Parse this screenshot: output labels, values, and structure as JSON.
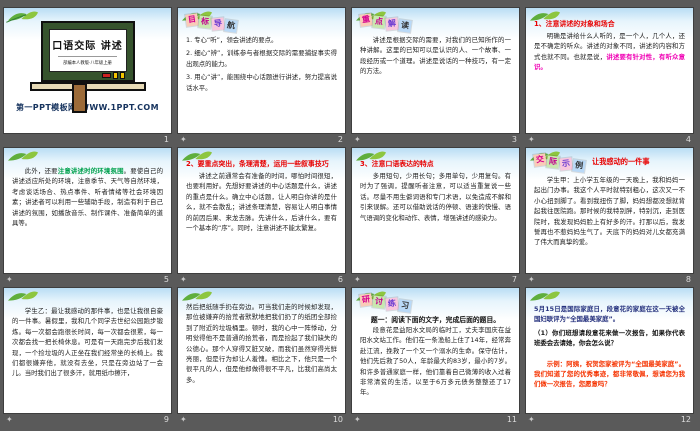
{
  "app": {
    "view_background": "#5a5a5a"
  },
  "colors": {
    "heading_red": "#e80000",
    "highlight_magenta": "#f000b4",
    "highlight_green": "#00a14e",
    "sample_red": "#f53300",
    "navy": "#26327e",
    "sky": "#b9ddf4"
  },
  "icons": {
    "animation_star": "✦"
  },
  "slides": [
    {
      "number": "1",
      "title": "口语交际 讲述",
      "subtitle": "部编本人教版·八年级上册",
      "footer": "第一PPT模板网-WWW.1PPT.COM"
    },
    {
      "number": "2",
      "header_tiles": [
        "目",
        "标",
        "导",
        "航"
      ],
      "items": [
        "1. 专心“听”，领会讲述的要点。",
        "2. 细心“辨”，训练参与者根据交际的需要捕捉事实得出观点的能力。",
        "3. 用心“讲”，能围绕中心话题进行讲述，努力提高说话水平。"
      ]
    },
    {
      "number": "3",
      "header_tiles": [
        "重",
        "点",
        "解",
        "读"
      ],
      "body": "讲述是根据交际的需要，对我们的已知所作的一种讲解。这里的已知可以是认识的人、一个故事、一段经历或一个道理。讲述是说话的一种技巧，有一定的方法。"
    },
    {
      "number": "4",
      "heading": "1、注意讲述的对象和场合",
      "body": "明确是讲给什么人听的，是一个人，几个人，还是不确定的听众。讲述的对象不同，讲述的内容和方式也就不同。也就是说，",
      "highlight": "讲述要有针对性，有听众意识。"
    },
    {
      "number": "5",
      "lead": "此外，还要",
      "highlight": "注意讲述时的环境氛围",
      "body": "。要使自己的讲述适应所处的环境，注意季节、天气等自然环境，考虑谈话场合、热点事件、听者情绪等社会环境因素；讲述者可以利用一些辅助手段，制造有利于自己讲述的氛围，如播放音乐、制作课件、准备简单的道具等。"
    },
    {
      "number": "6",
      "heading": "2、要重点突出，条理清楚，运用一些叙事技巧",
      "body": "讲述之前通常会有准备的时间，哪怕时间很短，也要利用好。先想好要讲述的中心话题是什么，讲述的重点是什么。确立中心话题，让人明白你讲的是什么，就不会散乱；讲述条理清楚，容易让人明白事情的前因后果、来龙去脉。先讲什么，后讲什么，要有一个基本的“序”。同时，注意讲述不能太繁复。"
    },
    {
      "number": "7",
      "heading": "3、注意口语表达的特点",
      "body": "多用短句，少用长句；多用单句，少用复句。有时为了强调，提醒听者注意，可以适当重复说一些话。尽量不用生僻词语和专门术语，以免造成不解和引来误解。还可以借助说话的停顿、语速的快慢、语气语调的变化和动作、表情，增强讲述的感染力。"
    },
    {
      "number": "8",
      "header_tiles": [
        "交",
        "际",
        "示",
        "例"
      ],
      "heading": "让我感动的一件事",
      "body": "学生甲：上小学五年级的一天晚上，我和妈妈一起出门办事。我这个人平时就特别粗心，这次又一不小心扭到脚了。看到我扭伤了脚，妈妈想都没想就背起我往医院跑。那时候的我特别胖，特别沉，走到医院时，我发现妈妈脸上有好多的汗。打那以后，我发誓再也不惹妈妈生气了。天底下的妈妈对儿女都充满了伟大而真挚的爱。"
    },
    {
      "number": "9",
      "body": "学生乙：最让我感动的那件事，也是让我很自豪的一件事。暑假里，我和几个同学去世纪公园跑步锻炼。每一次都会跑很长时间，每一次都会很累，每一次都会找一把长椅休息。可是有一天跑完步后我们发现，一个捡垃圾的人正坐在我们经常坐的长椅上。我们都很嫌弃他，就没有去坐，只是在旁边站了一会儿。当时我们出了很多汗，就用纸巾擦汗，"
    },
    {
      "number": "10",
      "body": "然后把纸随手扔在旁边。可当我们走的时候却发现，那位被嫌弃的拾荒者默默地把我们扔了的纸团全部捡到了附近的垃圾桶里。顿时，我的心中一阵悸动，分明觉得他不是普通的拾荒者，而是捡起了我们缺失的公德心。那个人穿得又脏又破，而我们虽然穿得光鲜亮丽，但是行为却让人羞愧。相比之下，他只是一个很平凡的人，但是他却做得很不平凡，比我们高尚太多。"
    },
    {
      "number": "11",
      "header_tiles": [
        "研",
        "讨",
        "练",
        "习"
      ],
      "heading": "题一：阅读下面的文字，完成后面的题目。",
      "body": "段意花是益阳水文局的临时工，丈夫李国庆在益阳水文站工作。他们在一条渔船上住了14年，经常奔赴江流，挽救了一个又一个溺水的生命。保守估计，他们先后救了50人，年龄最大的83岁，最小的7岁。和许多普通家庭一样，他们靠着自己微薄的收入过着非常清贫的生活，以至于6万多元债务整整还了17年。"
    },
    {
      "number": "12",
      "para1": "5月15日是国际家庭日，段意花的家庭在这一天被全国妇联评为“全国最美家庭”。",
      "para2": "（1）你们班想请段意花来做一次报告，如果你代表班委会去请她，你会怎么说？",
      "sample": "示例：阿姨，祝贺您家被评为“全国最美家庭”。我们知道了您的优秀事迹，都非常敬佩，想请您为我们做一次报告，您愿意吗？"
    }
  ]
}
